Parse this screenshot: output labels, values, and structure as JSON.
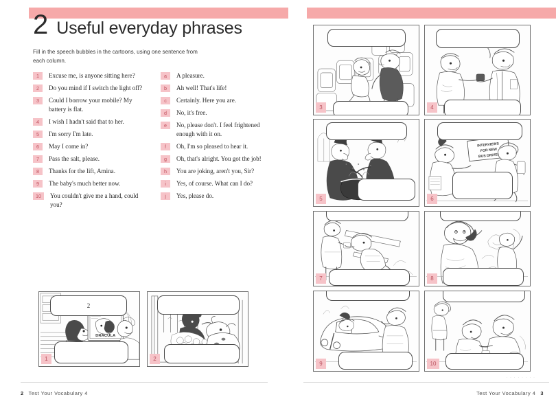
{
  "left_page": {
    "chapter_number": "2",
    "chapter_title": "Useful everyday phrases",
    "instructions": "Fill in the speech bubbles in the cartoons, using one sentence from each column.",
    "numbered_column": [
      {
        "marker": "1",
        "text": "Excuse me, is anyone sitting here?"
      },
      {
        "marker": "2",
        "text": "Do you mind if I switch the light off?"
      },
      {
        "marker": "3",
        "text": "Could I borrow your mobile? My battery is flat."
      },
      {
        "marker": "4",
        "text": "I wish I hadn't said that to her."
      },
      {
        "marker": "5",
        "text": "I'm sorry I'm late."
      },
      {
        "marker": "6",
        "text": "May I come in?"
      },
      {
        "marker": "7",
        "text": "Pass the salt, please."
      },
      {
        "marker": "8",
        "text": "Thanks for the lift, Amina."
      },
      {
        "marker": "9",
        "text": "The baby's much better now."
      },
      {
        "marker": "10",
        "text": "You couldn't give me a hand, could you?"
      }
    ],
    "lettered_column": [
      {
        "marker": "a",
        "text": "A pleasure."
      },
      {
        "marker": "b",
        "text": "Ah well! That's life!"
      },
      {
        "marker": "c",
        "text": "Certainly. Here you are."
      },
      {
        "marker": "d",
        "text": "No, it's free."
      },
      {
        "marker": "e",
        "text": "No, please don't. I feel frightened enough with it on."
      },
      {
        "marker": "f",
        "text": "Oh, I'm so pleased to hear it."
      },
      {
        "marker": "g",
        "text": "Oh, that's alright. You got the job!"
      },
      {
        "marker": "h",
        "text": "You are joking, aren't you, Sir?"
      },
      {
        "marker": "i",
        "text": "Yes, of course. What can I do?"
      },
      {
        "marker": "j",
        "text": "Yes, please do."
      }
    ],
    "panels": [
      {
        "number": "1",
        "scene": "two-people-watching-tv-dracula",
        "bubble_top_text": "2",
        "bubble_bottom_text": ""
      },
      {
        "number": "2",
        "scene": "person-in-bed-with-cow",
        "bubble_top_text": "",
        "bubble_bottom_text": ""
      }
    ],
    "footer": {
      "page": "2",
      "book": "Test Your Vocabulary 4"
    }
  },
  "right_page": {
    "panels": [
      {
        "number": "3",
        "scene": "airplane-cabin-seats-passenger"
      },
      {
        "number": "4",
        "scene": "two-men-talking-mobile-phone"
      },
      {
        "number": "5",
        "scene": "two-witches-cauldron"
      },
      {
        "number": "6",
        "scene": "bus-driver-interview-sign",
        "sign_text": "INTERVIEWS FOR NEW BUS DRIVER"
      },
      {
        "number": "7",
        "scene": "man-falling-over-plank"
      },
      {
        "number": "8",
        "scene": "woman-on-telephone-garden"
      },
      {
        "number": "9",
        "scene": "woman-in-car-man-outside"
      },
      {
        "number": "10",
        "scene": "men-at-dinner-table-passing-salt"
      }
    ],
    "footer": {
      "page": "3",
      "book": "Test Your Vocabulary 4"
    },
    "watermark": "· · · · · · · ·"
  },
  "colors": {
    "pink_bar": "#f6a9a9",
    "badge_bg": "#f6c3c8",
    "badge_text": "#c2525f",
    "panel_border": "#6e6e6e",
    "body_text": "#262626"
  }
}
